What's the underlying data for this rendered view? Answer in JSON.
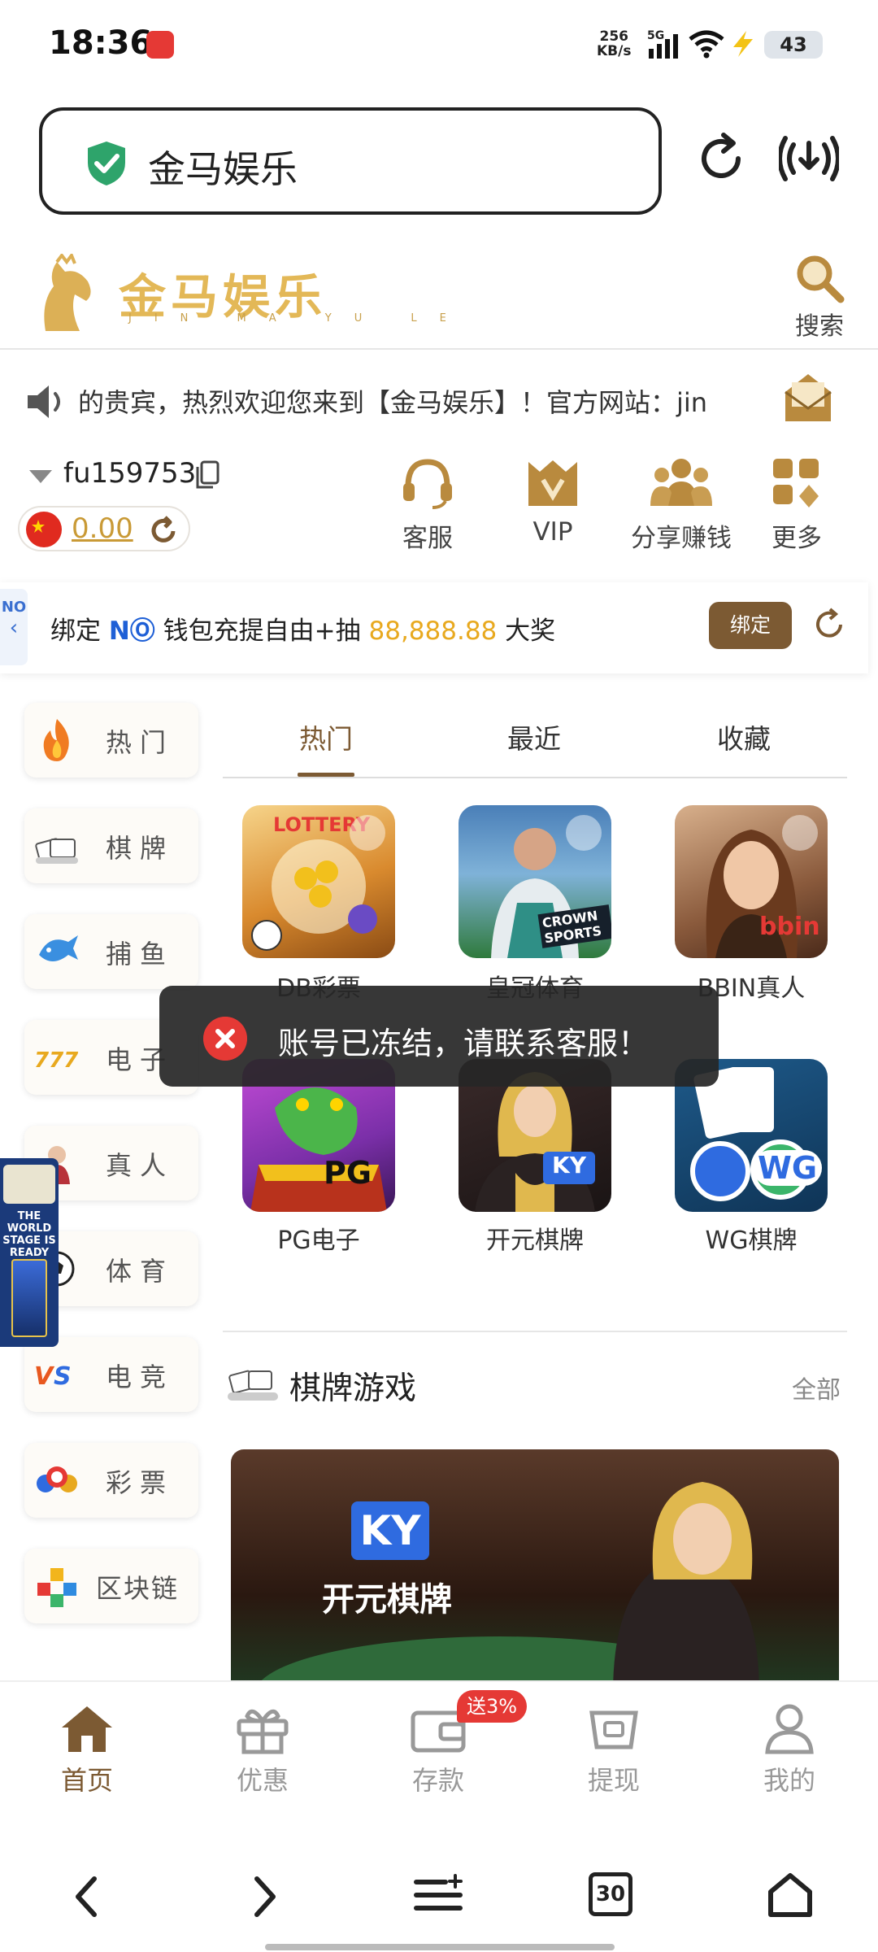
{
  "status_bar": {
    "time": "18:36",
    "net_speed_value": "256",
    "net_speed_unit": "KB/s",
    "network": "5G",
    "battery": "43"
  },
  "browser": {
    "address_title": "金马娱乐"
  },
  "site": {
    "logo_text": "金马娱乐",
    "logo_sub": "JIN MA YU LE",
    "search_label": "搜索",
    "marquee": "的贵宾，热烈欢迎您来到【金马娱乐】！官方网站：jin"
  },
  "user": {
    "username": "fu159753",
    "balance": "0.00"
  },
  "quick_actions": [
    {
      "label": "客服",
      "icon": "headset-icon"
    },
    {
      "label": "VIP",
      "icon": "vip-crown-icon"
    },
    {
      "label": "分享赚钱",
      "icon": "people-group-icon"
    },
    {
      "label": "更多",
      "icon": "grid-more-icon"
    }
  ],
  "bind_banner": {
    "side_label": "NO",
    "prefix": "绑定 ",
    "brand": "NⓄ",
    "middle": " 钱包充提自由+抽 ",
    "amount": "88,888.88",
    "suffix": " 大奖",
    "button": "绑定"
  },
  "side_nav": [
    {
      "label": "热门",
      "icon": "fire-icon"
    },
    {
      "label": "棋牌",
      "icon": "cards-icon"
    },
    {
      "label": "捕鱼",
      "icon": "fish-icon"
    },
    {
      "label": "电子",
      "icon": "slot-777-icon"
    },
    {
      "label": "真人",
      "icon": "live-dealer-icon"
    },
    {
      "label": "体育",
      "icon": "soccer-ball-icon"
    },
    {
      "label": "电竞",
      "icon": "vs-esports-icon"
    },
    {
      "label": "彩票",
      "icon": "lottery-balls-icon"
    },
    {
      "label": "区块链",
      "icon": "blockchain-cubes-icon"
    }
  ],
  "tabs": [
    "热门",
    "最近",
    "收藏"
  ],
  "games": [
    {
      "name": "DB彩票",
      "badge": "LOTTERY"
    },
    {
      "name": "皇冠体育",
      "badge": "CROWN SPORTS"
    },
    {
      "name": "BBIN真人",
      "badge": "bbin"
    },
    {
      "name": "PG电子",
      "badge": "PG"
    },
    {
      "name": "开元棋牌",
      "badge": "KY"
    },
    {
      "name": "WG棋牌",
      "badge": "WG"
    }
  ],
  "toast": {
    "message": "账号已冻结，请联系客服！"
  },
  "section": {
    "title": "棋牌游戏",
    "all": "全部",
    "banner_title": "开元棋牌",
    "banner_logo": "KY"
  },
  "float_ad": {
    "text": "THE WORLD STAGE IS READY"
  },
  "bottom_nav": [
    {
      "label": "首页",
      "icon": "home-icon"
    },
    {
      "label": "优惠",
      "icon": "gift-icon"
    },
    {
      "label": "存款",
      "icon": "wallet-icon"
    },
    {
      "label": "提现",
      "icon": "cash-withdraw-icon"
    },
    {
      "label": "我的",
      "icon": "user-profile-icon"
    }
  ],
  "deposit_promo": "送3%",
  "system_nav": {
    "tabs_count": "30"
  },
  "colors": {
    "brand_brown": "#7c5a33",
    "gold": "#e3b857",
    "amount_yellow": "#e8a91f",
    "error_red": "#e53935",
    "toast_bg": "#262626"
  }
}
